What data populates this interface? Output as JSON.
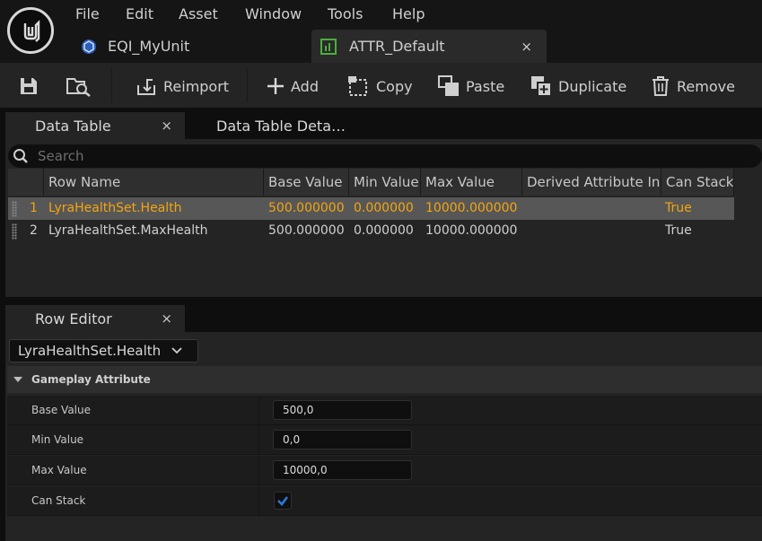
{
  "menu": [
    "File",
    "Edit",
    "Asset",
    "Window",
    "Tools",
    "Help"
  ],
  "doc_tabs": [
    {
      "label": "EQI_MyUnit"
    },
    {
      "label": "ATTR_Default",
      "close": "×"
    }
  ],
  "toolbar": {
    "reimport": "Reimport",
    "add": "Add",
    "copy": "Copy",
    "paste": "Paste",
    "duplicate": "Duplicate",
    "remove": "Remove"
  },
  "panels": {
    "data_table_tab": "Data Table",
    "data_table_close": "×",
    "details_tab": "Data Table Deta…",
    "row_editor_tab": "Row Editor",
    "row_editor_close": "×"
  },
  "search": {
    "placeholder": "Search"
  },
  "table": {
    "columns": [
      "Row Name",
      "Base Value",
      "Min Value",
      "Max Value",
      "Derived Attribute In",
      "Can Stack"
    ],
    "rows": [
      {
        "index": "1",
        "name": "LyraHealthSet.Health",
        "base": "500.000000",
        "min": "0.000000",
        "max": "10000.000000",
        "derived": "",
        "stack": "True",
        "selected": true
      },
      {
        "index": "2",
        "name": "LyraHealthSet.MaxHealth",
        "base": "500.000000",
        "min": "0.000000",
        "max": "10000.000000",
        "derived": "",
        "stack": "True",
        "selected": false
      }
    ]
  },
  "row_editor": {
    "selected_row": "LyraHealthSet.Health",
    "category": "Gameplay Attribute",
    "fields": [
      {
        "label": "Base Value",
        "value": "500,0"
      },
      {
        "label": "Min Value",
        "value": "0,0"
      },
      {
        "label": "Max Value",
        "value": "10000,0"
      },
      {
        "label": "Can Stack",
        "checked": true
      }
    ]
  },
  "colors": {
    "selected_text": "#f3a511",
    "checkbox": "#2a7ad8"
  }
}
